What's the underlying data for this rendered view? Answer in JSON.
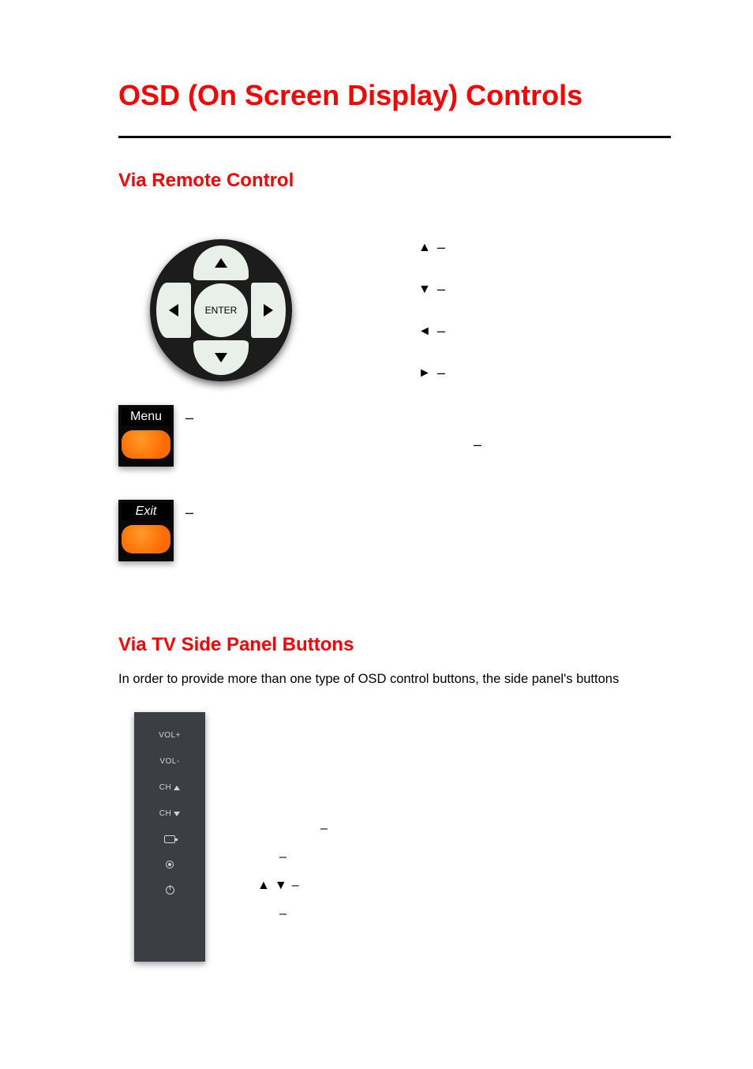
{
  "title": "OSD (On Screen Display) Controls",
  "section1": "Via Remote Control",
  "dpad": {
    "center": "ENTER"
  },
  "legend": {
    "up": {
      "glyph": "▲",
      "dash": "–"
    },
    "down": {
      "glyph": "▼",
      "dash": "–"
    },
    "left": {
      "glyph": "◄",
      "dash": "–"
    },
    "right": {
      "glyph": "►",
      "dash": "–"
    },
    "loneDash": "–"
  },
  "menuBtn": {
    "label": "Menu",
    "dash": "–"
  },
  "exitBtn": {
    "label": "Exit",
    "dash": "–"
  },
  "section2": "Via TV Side Panel Buttons",
  "bodyText": "In order to provide more than one type of OSD control buttons, the side panel's buttons",
  "sidePanel": {
    "volPlus": "VOL+",
    "volMinus": "VOL-",
    "chUp": "CH",
    "chDown": "CH"
  },
  "panelLegend": {
    "r1dash": "–",
    "r2dash": "–",
    "r3glyphUp": "▲",
    "r3glyphDown": "▼",
    "r3dash": "–",
    "r4dash": "–"
  }
}
